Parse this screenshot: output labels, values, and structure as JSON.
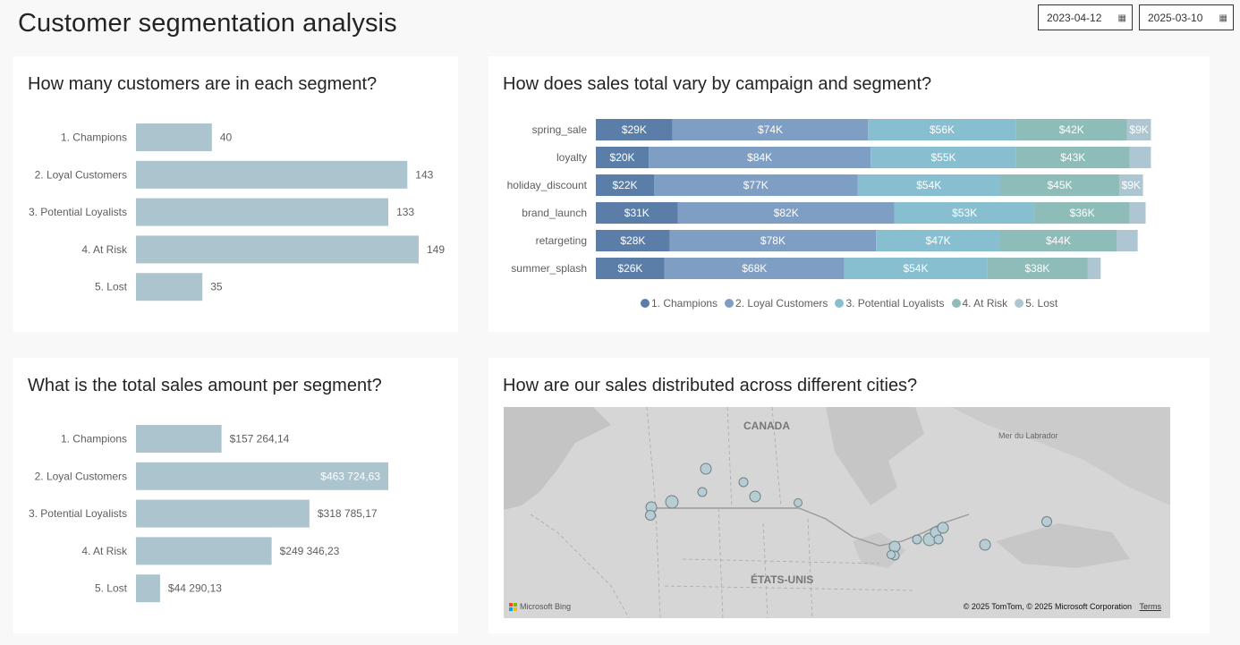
{
  "page": {
    "title": "Customer segmentation analysis",
    "date_start": "2023-04-12",
    "date_end": "2025-03-10"
  },
  "colors": {
    "bar": "#abc4cd",
    "segments": [
      "#5b7ea8",
      "#7f9ec3",
      "#88bfd0",
      "#8ebcb8",
      "#adc6d1"
    ]
  },
  "customers_chart": {
    "title": "How many customers are in each segment?",
    "chart_data": {
      "type": "bar",
      "orientation": "horizontal",
      "categories": [
        "1. Champions",
        "2. Loyal Customers",
        "3. Potential Loyalists",
        "4. At Risk",
        "5. Lost"
      ],
      "values": [
        40,
        143,
        133,
        149,
        35
      ],
      "labels": [
        "40",
        "143",
        "133",
        "149",
        "35"
      ],
      "xlim": [
        0,
        149
      ]
    }
  },
  "campaign_chart": {
    "title": "How does sales total vary by campaign and segment?",
    "chart_data": {
      "type": "bar",
      "orientation": "horizontal",
      "stacked": true,
      "categories": [
        "spring_sale",
        "loyalty",
        "holiday_discount",
        "brand_launch",
        "retargeting",
        "summer_splash"
      ],
      "series": [
        {
          "name": "1. Champions",
          "values": [
            29,
            20,
            22,
            31,
            28,
            26
          ],
          "labels": [
            "$29K",
            "$20K",
            "$22K",
            "$31K",
            "$28K",
            "$26K"
          ]
        },
        {
          "name": "2. Loyal Customers",
          "values": [
            74,
            84,
            77,
            82,
            78,
            68
          ],
          "labels": [
            "$74K",
            "$84K",
            "$77K",
            "$82K",
            "$78K",
            "$68K"
          ]
        },
        {
          "name": "3. Potential Loyalists",
          "values": [
            56,
            55,
            54,
            53,
            47,
            54
          ],
          "labels": [
            "$56K",
            "$55K",
            "$54K",
            "$53K",
            "$47K",
            "$54K"
          ]
        },
        {
          "name": "4. At Risk",
          "values": [
            42,
            43,
            45,
            36,
            44,
            38
          ],
          "labels": [
            "$42K",
            "$43K",
            "$45K",
            "$36K",
            "$44K",
            "$38K"
          ]
        },
        {
          "name": "5. Lost",
          "values": [
            9,
            8,
            9,
            6,
            8,
            5
          ],
          "labels": [
            "$9K",
            "",
            "$9K",
            "",
            "",
            ""
          ]
        }
      ],
      "unit": "K$",
      "legend_position": "bottom"
    }
  },
  "sales_chart": {
    "title": "What is the total sales amount per segment?",
    "chart_data": {
      "type": "bar",
      "orientation": "horizontal",
      "categories": [
        "1. Champions",
        "2. Loyal Customers",
        "3. Potential Loyalists",
        "4. At Risk",
        "5. Lost"
      ],
      "values": [
        157264.14,
        463724.63,
        318785.17,
        249346.23,
        44290.13
      ],
      "labels": [
        "$157 264,14",
        "$463 724,63",
        "$318 785,17",
        "$249 346,23",
        "$44 290,13"
      ],
      "xlim": [
        0,
        463724.63
      ]
    }
  },
  "map": {
    "title": "How are our sales distributed across different cities?",
    "label_canada": "CANADA",
    "label_us": "ÉTATS-UNIS",
    "label_labrador": "Mer du Labrador",
    "brand": "Microsoft Bing",
    "copyright": "© 2025 TomTom, © 2025 Microsoft Corporation",
    "terms": "Terms"
  }
}
